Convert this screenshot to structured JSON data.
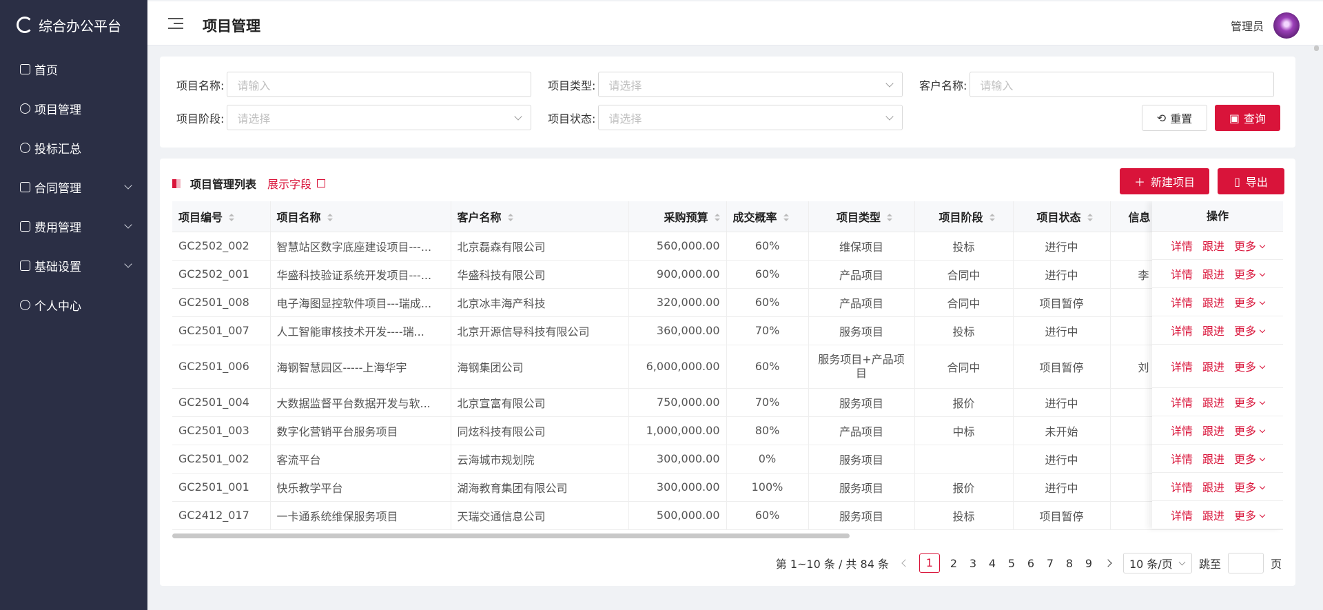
{
  "app": {
    "title": "综合办公平台"
  },
  "sidebar": {
    "items": [
      {
        "label": "首页"
      },
      {
        "label": "项目管理"
      },
      {
        "label": "投标汇总"
      },
      {
        "label": "合同管理"
      },
      {
        "label": "费用管理"
      },
      {
        "label": "基础设置"
      },
      {
        "label": "个人中心"
      }
    ]
  },
  "header": {
    "title": "项目管理",
    "user": "管理员"
  },
  "filter": {
    "project_name_label": "项目名称:",
    "project_name_placeholder": "请输入",
    "project_type_label": "项目类型:",
    "project_type_placeholder": "请选择",
    "customer_label": "客户名称:",
    "customer_placeholder": "请输入",
    "stage_label": "项目阶段:",
    "stage_placeholder": "请选择",
    "status_label": "项目状态:",
    "status_placeholder": "请选择",
    "reset_label": "重置",
    "query_label": "查询"
  },
  "list": {
    "title": "项目管理列表",
    "show_fields": "展示字段",
    "new_label": "新建项目",
    "export_label": "导出",
    "columns": [
      "项目编号",
      "项目名称",
      "客户名称",
      "采购预算",
      "成交概率",
      "项目类型",
      "项目阶段",
      "项目状态",
      "信息",
      "操作"
    ],
    "rows": [
      [
        "GC2502_002",
        "智慧站区数字底座建设项目---...",
        "北京磊森有限公司",
        "560,000.00",
        "60%",
        "维保项目",
        "投标",
        "进行中",
        ""
      ],
      [
        "GC2502_001",
        "华盛科技验证系统开发项目---...",
        "华盛科技有限公司",
        "900,000.00",
        "60%",
        "产品项目",
        "合同中",
        "进行中",
        "李"
      ],
      [
        "GC2501_008",
        "电子海图显控软件项目---瑞成...",
        "北京冰丰海产科技",
        "320,000.00",
        "60%",
        "产品项目",
        "合同中",
        "项目暂停",
        ""
      ],
      [
        "GC2501_007",
        "人工智能审核技术开发----瑞...",
        "北京开源信导科技有限公司",
        "360,000.00",
        "70%",
        "服务项目",
        "投标",
        "进行中",
        ""
      ],
      [
        "GC2501_006",
        "海钢智慧园区-----上海华宇",
        "海钢集团公司",
        "6,000,000.00",
        "60%",
        "服务项目+产品项目",
        "合同中",
        "项目暂停",
        "刘"
      ],
      [
        "GC2501_004",
        "大数据监督平台数据开发与软...",
        "北京宣富有限公司",
        "750,000.00",
        "70%",
        "服务项目",
        "报价",
        "进行中",
        ""
      ],
      [
        "GC2501_003",
        "数字化营销平台服务项目",
        "同炫科技有限公司",
        "1,000,000.00",
        "80%",
        "产品项目",
        "中标",
        "未开始",
        ""
      ],
      [
        "GC2501_002",
        "客流平台",
        "云海城市规划院",
        "300,000.00",
        "0%",
        "服务项目",
        "",
        "进行中",
        ""
      ],
      [
        "GC2501_001",
        "快乐教学平台",
        "湖海教育集团有限公司",
        "300,000.00",
        "100%",
        "服务项目",
        "报价",
        "进行中",
        ""
      ],
      [
        "GC2412_017",
        "一卡通系统维保服务项目",
        "天瑞交通信息公司",
        "500,000.00",
        "60%",
        "服务项目",
        "投标",
        "项目暂停",
        ""
      ]
    ],
    "actions": {
      "detail": "详情",
      "follow": "跟进",
      "more": "更多"
    }
  },
  "pagination": {
    "summary": "第 1~10 条 / 共 84 条",
    "pages": [
      "1",
      "2",
      "3",
      "4",
      "5",
      "6",
      "7",
      "8",
      "9"
    ],
    "page_size": "10 条/页",
    "jump_label": "跳至",
    "page_unit": "页"
  },
  "colors": {
    "accent": "#d9143a",
    "sidebar": "#2b2f45"
  }
}
